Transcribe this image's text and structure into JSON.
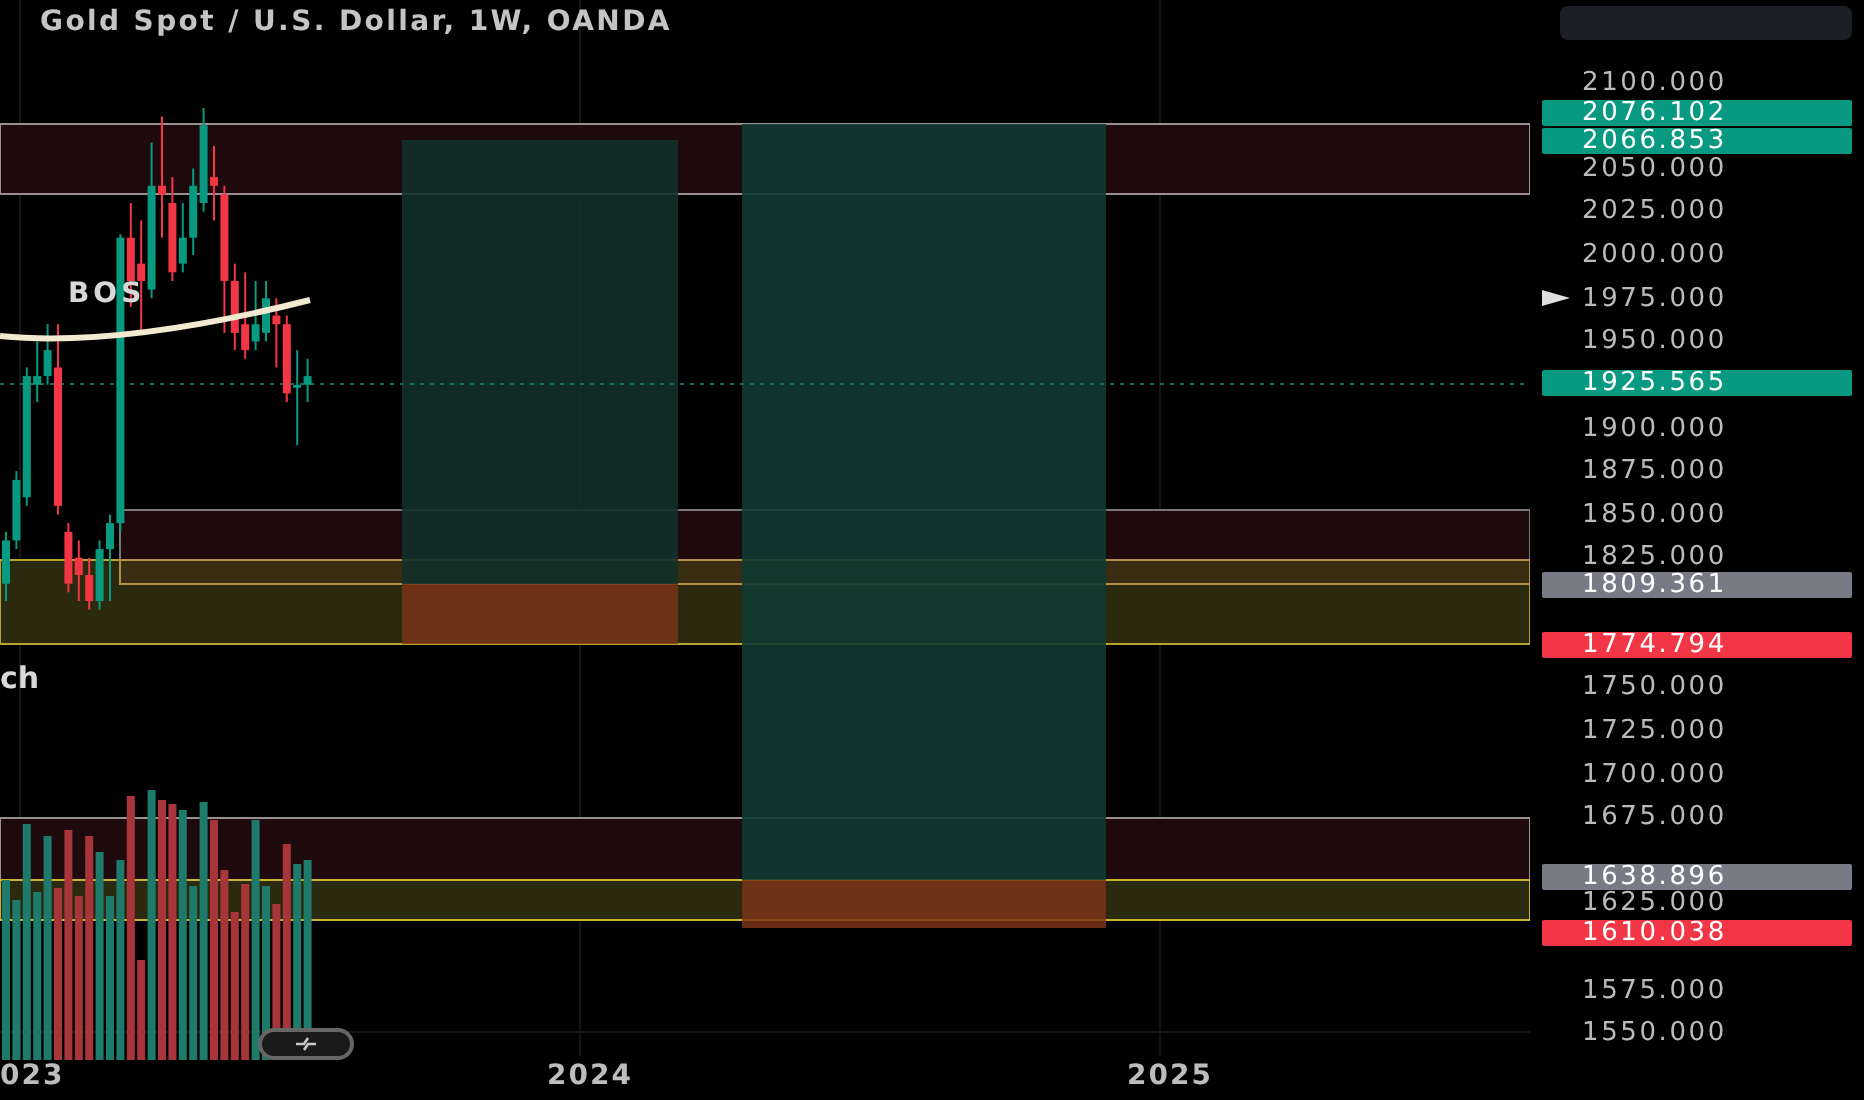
{
  "title": "Gold Spot / U.S. Dollar, 1W, OANDA",
  "price_ticks": [
    "2100.000",
    "2050.000",
    "2025.000",
    "2000.000",
    "1975.000",
    "1950.000",
    "1900.000",
    "1875.000",
    "1850.000",
    "1825.000",
    "1750.000",
    "1725.000",
    "1700.000",
    "1675.000",
    "1625.000",
    "1575.000",
    "1550.000"
  ],
  "price_labels": [
    {
      "label": "2076.102",
      "color": "#089981"
    },
    {
      "label": "2066.853",
      "color": "#089981"
    },
    {
      "label": "1925.565",
      "color": "#089981"
    },
    {
      "label": "1809.361",
      "color": "#787b86"
    },
    {
      "label": "1774.794",
      "color": "#f23645"
    },
    {
      "label": "1638.896",
      "color": "#787b86"
    },
    {
      "label": "1610.038",
      "color": "#f23645"
    }
  ],
  "bos_label": "BOS",
  "cut_label": "ch",
  "time_axis": [
    "023",
    "2024",
    "2025"
  ]
}
